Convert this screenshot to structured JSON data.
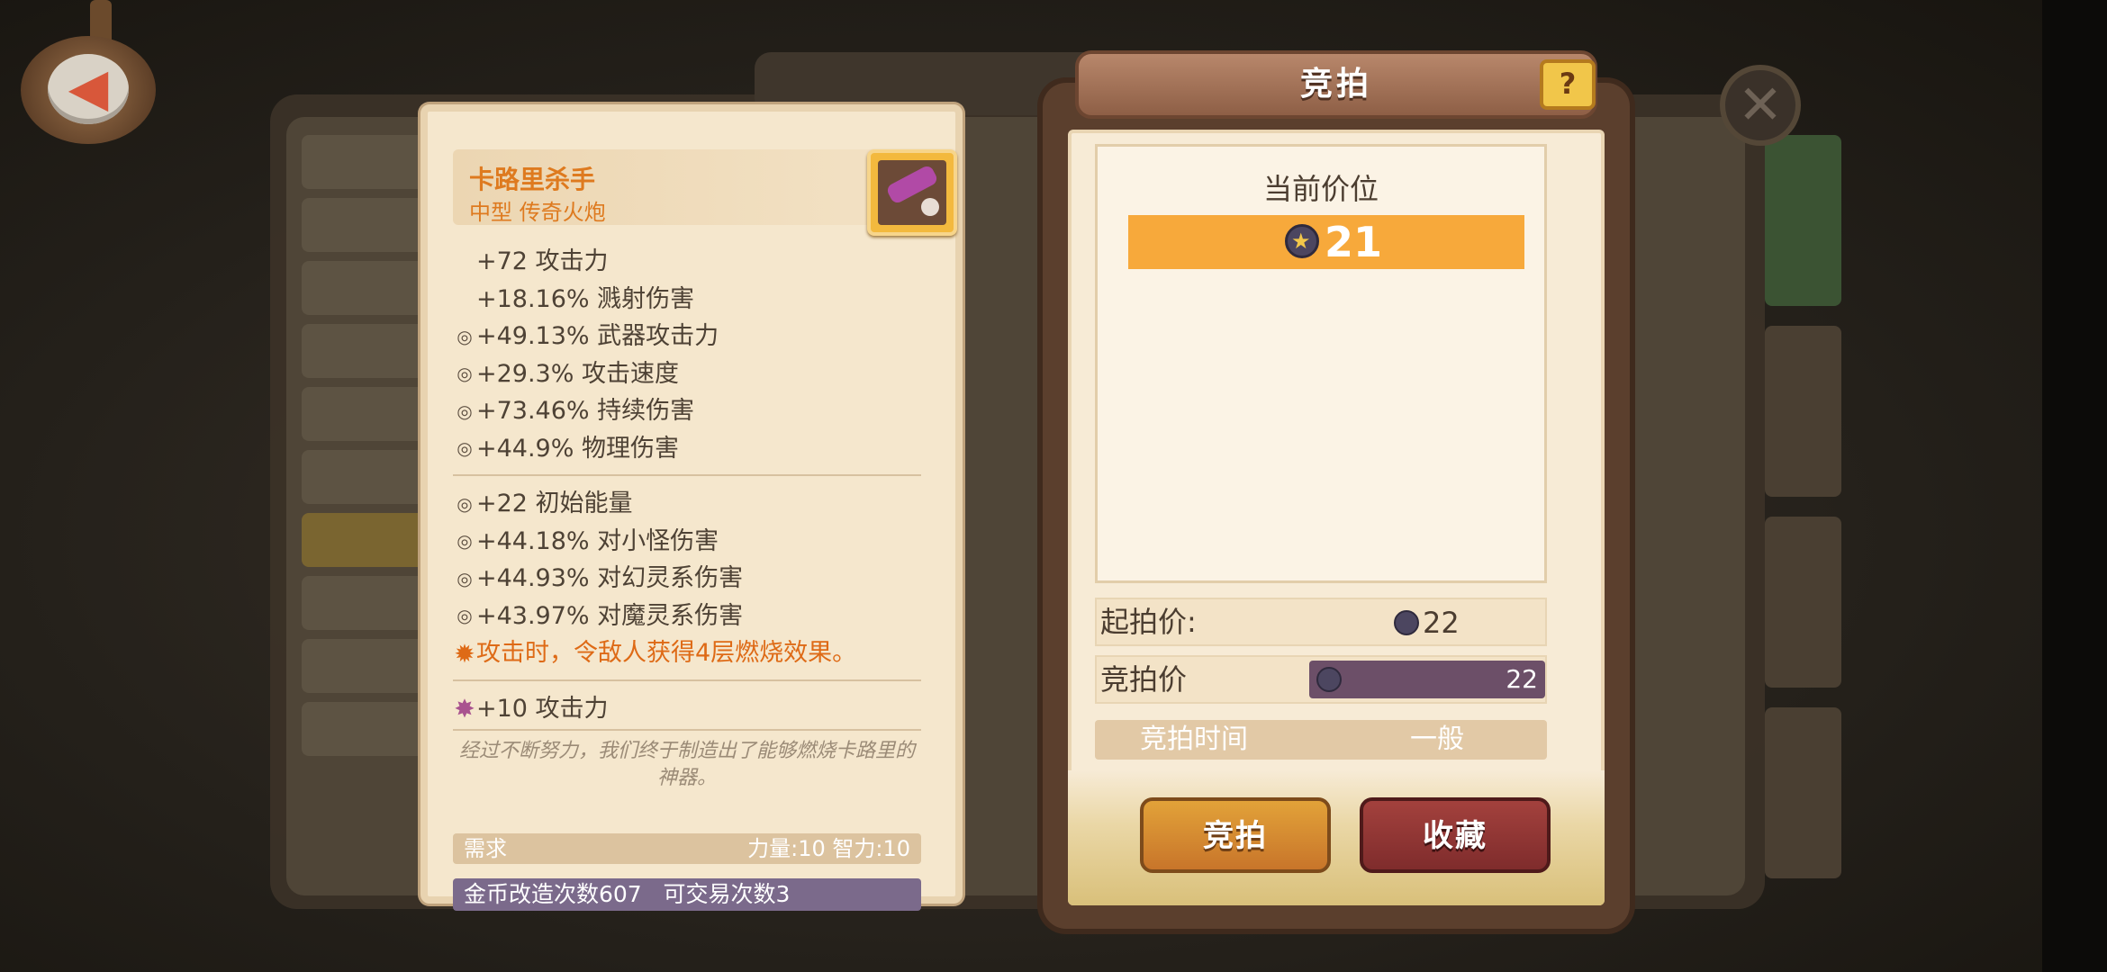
{
  "item": {
    "name": "卡路里杀手",
    "type": "中型 传奇火炮",
    "base_stats": [
      "+72 攻击力",
      "+18.16% 溅射伤害"
    ],
    "random_stats_1": [
      "+49.13% 武器攻击力",
      "+29.3% 攻击速度",
      "+73.46% 持续伤害",
      "+44.9% 物理伤害"
    ],
    "random_stats_2": [
      "+22 初始能量",
      "+44.18% 对小怪伤害",
      "+44.93% 对幻灵系伤害",
      "+43.97% 对魔灵系伤害"
    ],
    "special_effect": "攻击时，令敌人获得4层燃烧效果。",
    "rune_stat": "+10 攻击力",
    "flavor": "经过不断努力，我们终于制造出了能够燃烧卡路里的神器。",
    "requirement_label": "需求",
    "requirement_value": "力量:10 智力:10",
    "trade_info": "金币改造次数607   可交易次数3"
  },
  "auction": {
    "title": "竞拍",
    "help": "?",
    "current_price_label": "当前价位",
    "current_price": "21",
    "start_price_label": "起拍价:",
    "start_price": "22",
    "bid_price_label": "竞拍价",
    "bid_price": "22",
    "time_label": "竞拍时间",
    "time_value": "一般",
    "bid_button": "竞拍",
    "favorite_button": "收藏"
  },
  "colors": {
    "accent_orange": "#de7a1f",
    "price_bar": "#f7a93b",
    "bid_input": "#6c4f68",
    "trade_bar": "#7b6a8b"
  },
  "icons": {
    "back": "back-arrow-icon",
    "close": "close-icon",
    "coin": "star-coin-icon",
    "cannon": "cannon-icon"
  }
}
